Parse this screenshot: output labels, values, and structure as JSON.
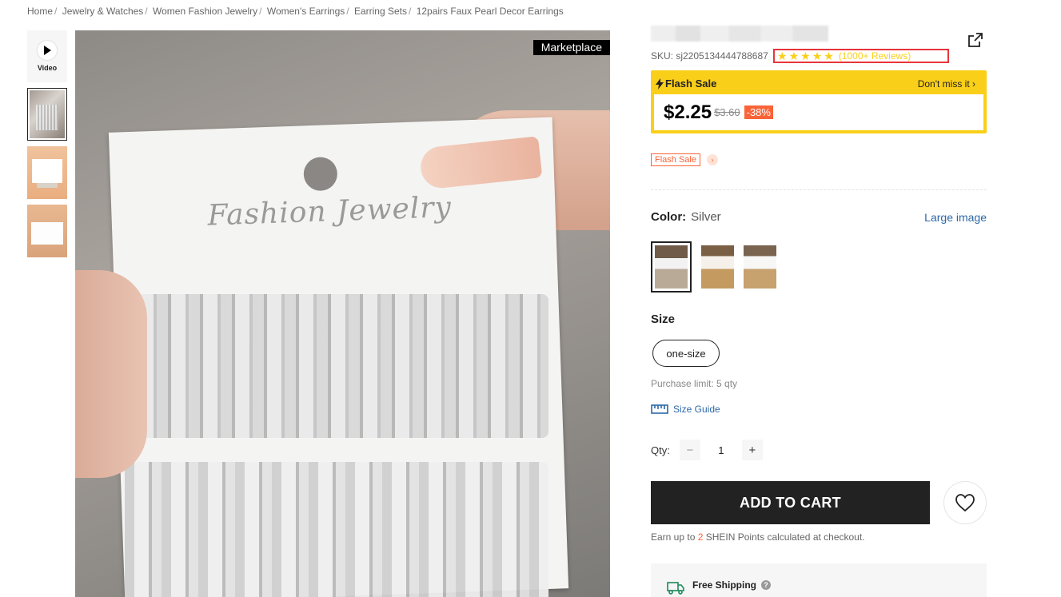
{
  "breadcrumb": {
    "items": [
      "Home",
      "Jewelry & Watches",
      "Women Fashion Jewelry",
      "Women's Earrings",
      "Earring Sets"
    ],
    "separator": "/",
    "current": "12pairs Faux Pearl Decor Earrings"
  },
  "gallery": {
    "video_label": "Video",
    "marketplace_tag": "Marketplace",
    "card_brand_text": "Fashion Jewelry"
  },
  "product": {
    "sku": "SKU: sj2205134444788687",
    "rating": {
      "stars": 5,
      "reviews_text": "(1000+ Reviews)"
    }
  },
  "flash_sale": {
    "title": "Flash Sale",
    "dont_miss": "Don't miss it ›",
    "price": "$2.25",
    "original_price": "$3.60",
    "discount": "-38%",
    "tag": "Flash Sale"
  },
  "color": {
    "label": "Color:",
    "value": "Silver",
    "large_image_link": "Large image"
  },
  "size": {
    "label": "Size",
    "selected": "one-size",
    "purchase_limit": "Purchase limit: 5 qty",
    "size_guide": "Size Guide"
  },
  "quantity": {
    "label": "Qty:",
    "value": "1",
    "minus": "−",
    "plus": "+"
  },
  "cart": {
    "add_to_cart": "ADD TO CART",
    "points_prefix": "Earn up to",
    "points_value": "2",
    "points_suffix": "SHEIN Points calculated at checkout."
  },
  "shipping": {
    "label": "Free Shipping",
    "help": "?"
  },
  "colors": {
    "accent_yellow": "#facf19",
    "sale_orange": "#fa6338",
    "link_blue": "#2d68a8",
    "highlight_red": "#e8343b"
  }
}
